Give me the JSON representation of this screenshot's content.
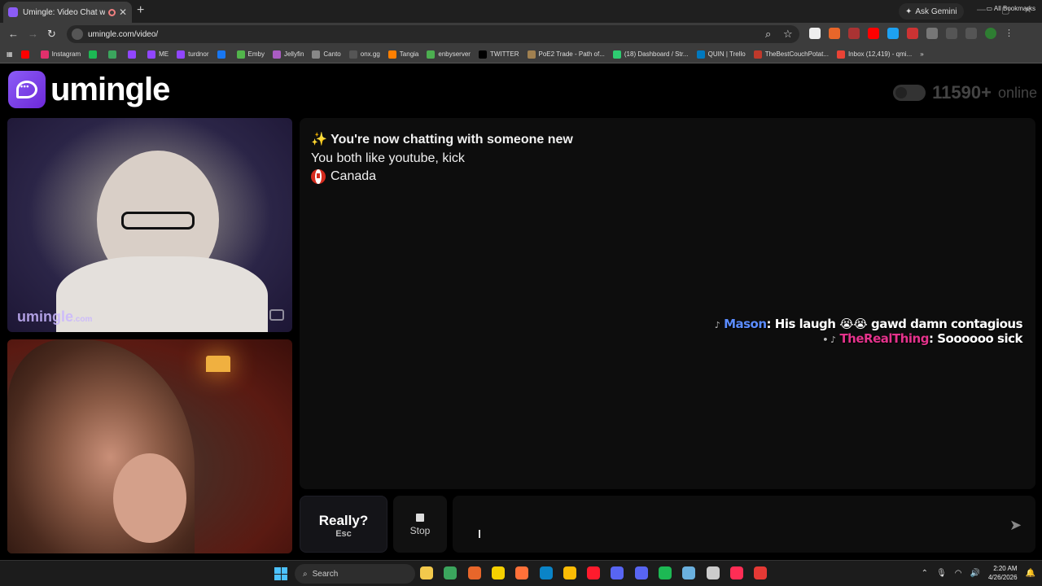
{
  "browser": {
    "tab_title": "Umingle: Video Chat with S",
    "tab_close": "✕",
    "new_tab": "+",
    "ask_gemini": "Ask Gemini",
    "url": "umingle.com/video/",
    "bookmarks": [
      {
        "label": "",
        "color": "#ff0000"
      },
      {
        "label": "Instagram",
        "color": "#e1306c"
      },
      {
        "label": "",
        "color": "#1db954"
      },
      {
        "label": "",
        "color": "#3ba55d"
      },
      {
        "label": "",
        "color": "#9146ff"
      },
      {
        "label": "ME",
        "color": "#9146ff"
      },
      {
        "label": "turdnor",
        "color": "#9146ff"
      },
      {
        "label": "",
        "color": "#1877f2"
      },
      {
        "label": "Emby",
        "color": "#52b54b"
      },
      {
        "label": "Jellyfin",
        "color": "#aa5cc3"
      },
      {
        "label": "Canto",
        "color": "#888888"
      },
      {
        "label": "onx.gg",
        "color": "#555555"
      },
      {
        "label": "Tangia",
        "color": "#ff7f00"
      },
      {
        "label": "enbyserver",
        "color": "#4caf50"
      },
      {
        "label": "TWITTER",
        "color": "#000000"
      },
      {
        "label": "PoE2 Trade - Path of...",
        "color": "#a08050"
      },
      {
        "label": "(18) Dashboard / Str...",
        "color": "#2ecc71"
      },
      {
        "label": "QUIN | Trello",
        "color": "#0079bf"
      },
      {
        "label": "TheBestCouchPotat...",
        "color": "#c0392b"
      },
      {
        "label": "Inbox (12,419) - qmi...",
        "color": "#ea4335"
      }
    ],
    "bookmarks_more": "»",
    "all_bookmarks": "All Bookmarks"
  },
  "site": {
    "logo_text": "umingle",
    "online_count": "11590+",
    "online_label": "online"
  },
  "videos": {
    "watermark_main": "umingle",
    "watermark_suffix": ".com"
  },
  "chat": {
    "line1": "✨ You're now chatting with someone new",
    "line2": "You both like youtube, kick",
    "country": "Canada"
  },
  "overlay": {
    "msg1_icon": "♪",
    "msg1_user": "Mason",
    "msg1_text": ": His laugh 😭😭 gawd damn contagious",
    "msg2_icon": "• ♪",
    "msg2_user": "TheRealThing",
    "msg2_text": ": Soooooo sick"
  },
  "controls": {
    "really_label": "Really?",
    "really_key": "Esc",
    "stop_label": "Stop",
    "send_icon": "➤"
  },
  "taskbar": {
    "search_label": "Search",
    "time": "2:20 AM",
    "date": "4/26/2026",
    "icons": [
      {
        "name": "files-icon",
        "color": "#f2c94c"
      },
      {
        "name": "play-icon",
        "color": "#3ba55d"
      },
      {
        "name": "basketball-icon",
        "color": "#e8662a"
      },
      {
        "name": "notes-icon",
        "color": "#f5d000"
      },
      {
        "name": "firefox-icon",
        "color": "#ff7139"
      },
      {
        "name": "edge-icon",
        "color": "#0a84c7"
      },
      {
        "name": "chrome-icon",
        "color": "#fbbc05"
      },
      {
        "name": "opera-icon",
        "color": "#ff1b2d"
      },
      {
        "name": "app-icon",
        "color": "#5865f2"
      },
      {
        "name": "discord-icon",
        "color": "#5865f2"
      },
      {
        "name": "spotify-icon",
        "color": "#1db954"
      },
      {
        "name": "notepad-icon",
        "color": "#6ab0de"
      },
      {
        "name": "obs-icon",
        "color": "#cccccc"
      },
      {
        "name": "tiktok-icon",
        "color": "#ff2d55"
      },
      {
        "name": "record-icon",
        "color": "#e53935"
      }
    ]
  }
}
